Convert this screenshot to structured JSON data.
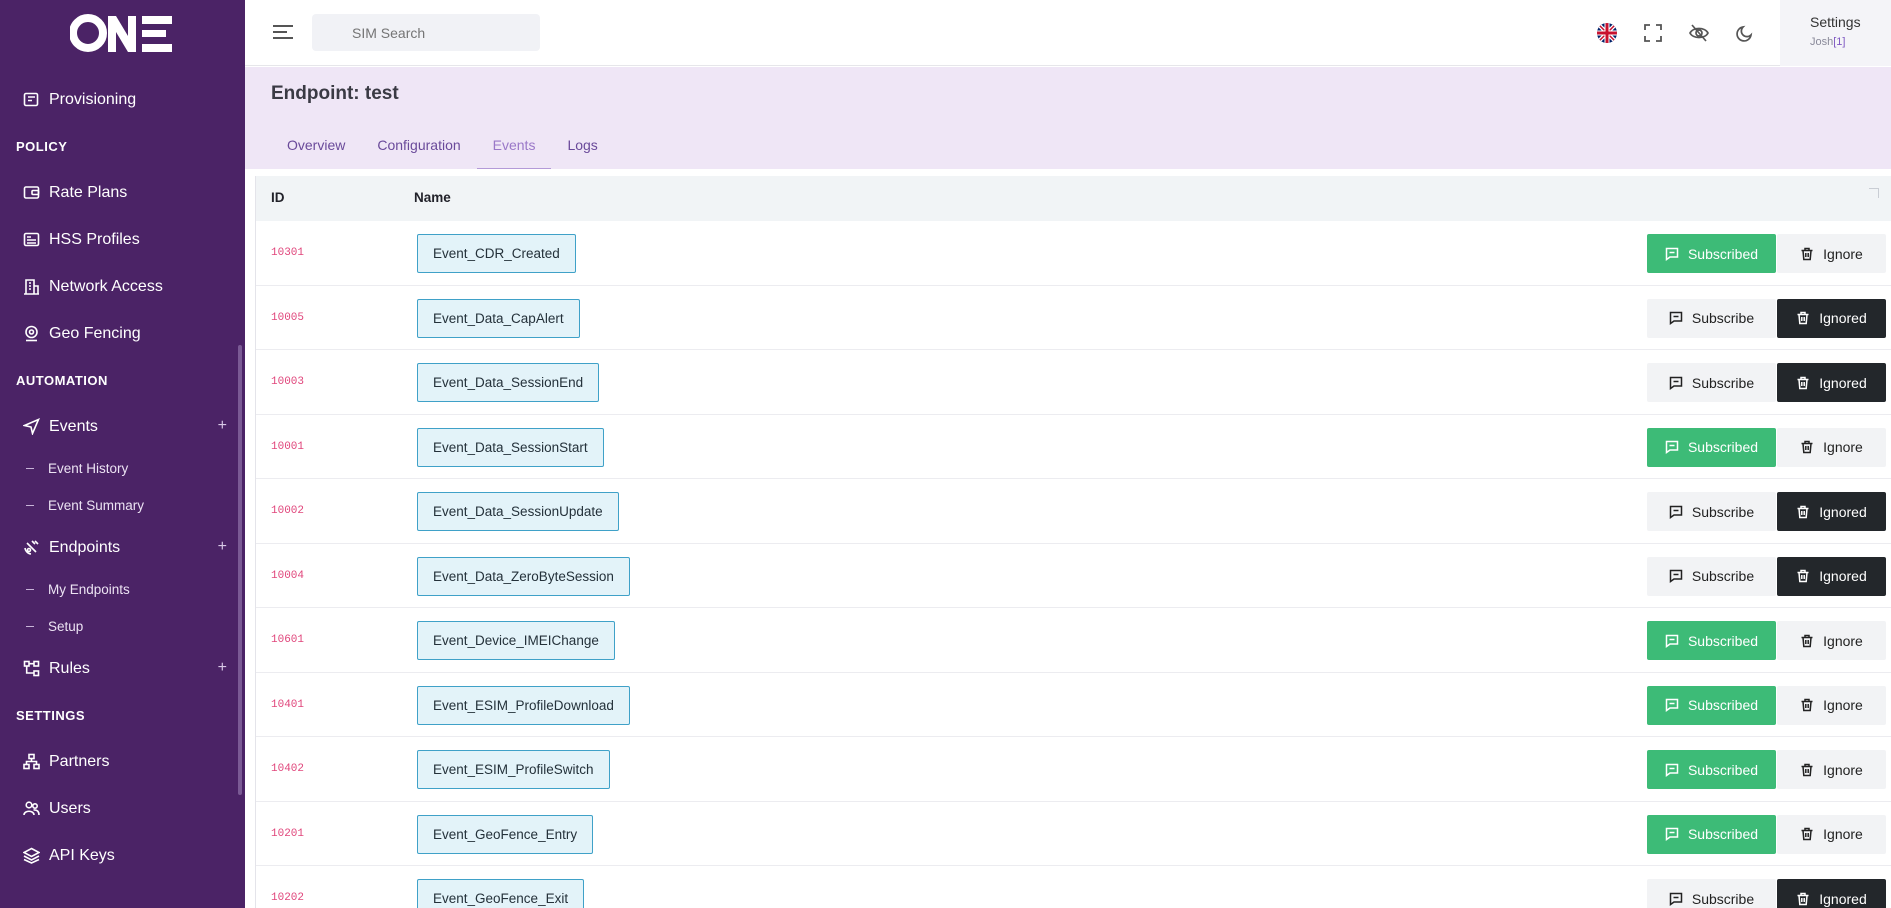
{
  "app": {
    "logo_text": "ONE"
  },
  "sidebar": {
    "items": [
      {
        "kind": "item",
        "label": "Provisioning",
        "icon": "provisioning-icon"
      },
      {
        "kind": "section",
        "label": "POLICY"
      },
      {
        "kind": "item",
        "label": "Rate Plans",
        "icon": "wallet-icon"
      },
      {
        "kind": "item",
        "label": "HSS Profiles",
        "icon": "list-card-icon"
      },
      {
        "kind": "item",
        "label": "Network Access",
        "icon": "building-icon"
      },
      {
        "kind": "item",
        "label": "Geo Fencing",
        "icon": "map-pin-icon"
      },
      {
        "kind": "section",
        "label": "AUTOMATION"
      },
      {
        "kind": "item",
        "label": "Events",
        "icon": "send-icon",
        "expand": "+"
      },
      {
        "kind": "sub",
        "label": "Event History"
      },
      {
        "kind": "sub",
        "label": "Event Summary"
      },
      {
        "kind": "item",
        "label": "Endpoints",
        "icon": "satellite-icon",
        "expand": "+"
      },
      {
        "kind": "sub",
        "label": "My Endpoints"
      },
      {
        "kind": "sub",
        "label": "Setup"
      },
      {
        "kind": "item",
        "label": "Rules",
        "icon": "flow-icon",
        "expand": "+"
      },
      {
        "kind": "section",
        "label": "SETTINGS"
      },
      {
        "kind": "item",
        "label": "Partners",
        "icon": "hierarchy-icon"
      },
      {
        "kind": "item",
        "label": "Users",
        "icon": "users-icon"
      },
      {
        "kind": "item",
        "label": "API Keys",
        "icon": "layers-icon"
      }
    ]
  },
  "topbar": {
    "search_placeholder": "SIM Search",
    "settings_label": "Settings",
    "user_name": "Josh",
    "user_count": "[1]",
    "icons": [
      "uk-flag-icon",
      "fullscreen-icon",
      "eye-off-icon",
      "moon-icon"
    ]
  },
  "page": {
    "title": "Endpoint: test",
    "tabs": [
      {
        "label": "Overview",
        "active": false
      },
      {
        "label": "Configuration",
        "active": false
      },
      {
        "label": "Events",
        "active": true
      },
      {
        "label": "Logs",
        "active": false
      }
    ]
  },
  "table": {
    "columns": {
      "id": "ID",
      "name": "Name"
    },
    "subscribe_label": "Subscribe",
    "subscribed_label": "Subscribed",
    "ignore_label": "Ignore",
    "ignored_label": "Ignored",
    "rows": [
      {
        "id": "10301",
        "name": "Event_CDR_Created",
        "subscribed": true
      },
      {
        "id": "10005",
        "name": "Event_Data_CapAlert",
        "subscribed": false
      },
      {
        "id": "10003",
        "name": "Event_Data_SessionEnd",
        "subscribed": false
      },
      {
        "id": "10001",
        "name": "Event_Data_SessionStart",
        "subscribed": true
      },
      {
        "id": "10002",
        "name": "Event_Data_SessionUpdate",
        "subscribed": false
      },
      {
        "id": "10004",
        "name": "Event_Data_ZeroByteSession",
        "subscribed": false
      },
      {
        "id": "10601",
        "name": "Event_Device_IMEIChange",
        "subscribed": true
      },
      {
        "id": "10401",
        "name": "Event_ESIM_ProfileDownload",
        "subscribed": true
      },
      {
        "id": "10402",
        "name": "Event_ESIM_ProfileSwitch",
        "subscribed": true
      },
      {
        "id": "10201",
        "name": "Event_GeoFence_Entry",
        "subscribed": true
      },
      {
        "id": "10202",
        "name": "Event_GeoFence_Exit",
        "subscribed": false
      }
    ]
  },
  "colors": {
    "sidebar_bg": "#4b2366",
    "subscribed_green": "#3dbb77",
    "ignored_dark": "#23272b",
    "id_pink": "#e0457b",
    "chip_border": "#3fa1c8"
  }
}
